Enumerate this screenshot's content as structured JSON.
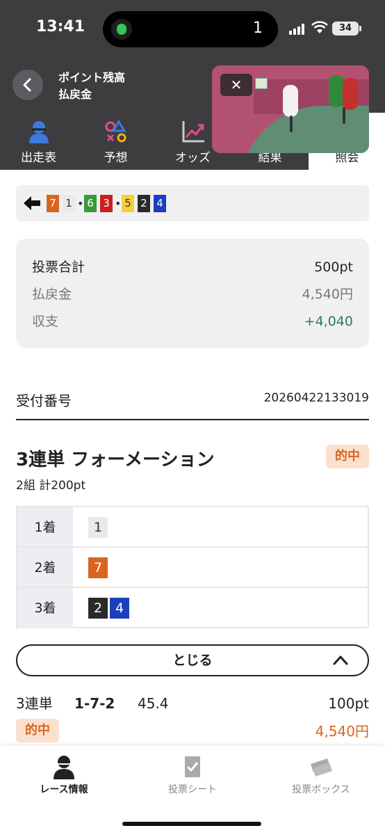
{
  "status_bar": {
    "time": "13:41",
    "island_count": "1",
    "battery": "34"
  },
  "header": {
    "back_icon": "chevron-left-icon",
    "points_line1": "ポイント残高",
    "points_line2": "払戻金"
  },
  "video": {
    "close_label": "✕"
  },
  "tabs": [
    {
      "label": "出走表",
      "icon": "person-icon",
      "active": false
    },
    {
      "label": "予想",
      "icon": "prediction-shapes-icon",
      "active": false
    },
    {
      "label": "オッズ",
      "icon": "trend-chart-icon",
      "active": false
    },
    {
      "label": "結果",
      "icon": "result-icon",
      "active": false
    },
    {
      "label": "照会",
      "icon": "inquiry-icon",
      "active": true
    }
  ],
  "combination": {
    "boxes": [
      {
        "num": "7",
        "bg": "#d9661f",
        "fg": "#ffffff"
      },
      {
        "num": "1",
        "bg": "#e9e9ec",
        "fg": "#333333"
      },
      {
        "num": "6",
        "bg": "#3a9a3a",
        "fg": "#ffffff"
      },
      {
        "num": "3",
        "bg": "#c8201e",
        "fg": "#ffffff"
      },
      {
        "num": "5",
        "bg": "#f6cf3b",
        "fg": "#333333"
      },
      {
        "num": "2",
        "bg": "#2a2a2a",
        "fg": "#ffffff"
      },
      {
        "num": "4",
        "bg": "#1c3fbe",
        "fg": "#ffffff"
      }
    ],
    "separator": "•"
  },
  "summary": {
    "rows": [
      {
        "label": "投票合計",
        "value": "500pt",
        "value_color": "#222222",
        "label_color": "#222222"
      },
      {
        "label": "払戻金",
        "value": "4,540円",
        "value_color": "#777777",
        "label_color": "#777777"
      },
      {
        "label": "収支",
        "value": "+4,040",
        "value_color": "#2f7a4f",
        "label_color": "#777777"
      }
    ]
  },
  "receipt": {
    "label": "受付番号",
    "value": "20260422133019"
  },
  "bet": {
    "title": "3連単 フォーメーション",
    "badge": "的中",
    "sub": "2組 計200pt",
    "positions": [
      {
        "label": "1着",
        "boxes": [
          {
            "num": "1",
            "bg": "#e9e9ec",
            "fg": "#333333"
          }
        ]
      },
      {
        "label": "2着",
        "boxes": [
          {
            "num": "7",
            "bg": "#d9661f",
            "fg": "#ffffff"
          }
        ]
      },
      {
        "label": "3着",
        "boxes": [
          {
            "num": "2",
            "bg": "#2a2a2a",
            "fg": "#ffffff"
          },
          {
            "num": "4",
            "bg": "#1c3fbe",
            "fg": "#ffffff"
          }
        ]
      }
    ],
    "close_label": "とじる"
  },
  "result": {
    "type": "3連単",
    "combo": "1-7-2",
    "odds": "45.4",
    "stake": "100pt",
    "badge": "的中",
    "payout": "4,540円"
  },
  "bottom_nav": [
    {
      "label": "レース情報",
      "icon": "race-info-icon",
      "active": true
    },
    {
      "label": "投票シート",
      "icon": "vote-sheet-icon",
      "active": false
    },
    {
      "label": "投票ボックス",
      "icon": "ticket-box-icon",
      "active": false
    }
  ],
  "colors": {
    "accent": "#d9661f",
    "header": "#3d3d3f",
    "positive": "#2f7a4f"
  }
}
